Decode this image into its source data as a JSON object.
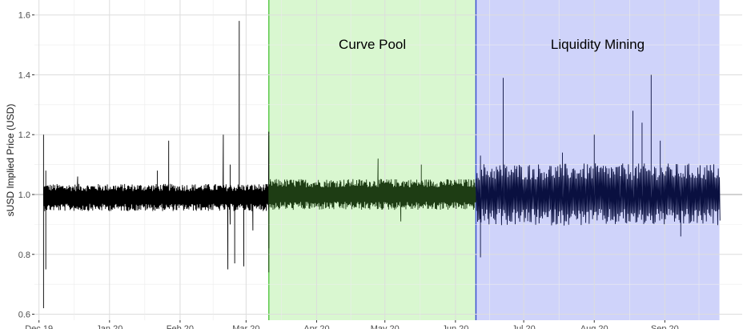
{
  "chart_data": {
    "type": "line",
    "ylabel": "sUSD Implied Price (USD)",
    "xlabel": "",
    "ylim": [
      0.58,
      1.65
    ],
    "xlim": [
      "2019-11-29",
      "2020-10-05"
    ],
    "grid": true,
    "yticks": [
      0.6,
      0.8,
      1.0,
      1.2,
      1.4,
      1.6
    ],
    "ytick_labels": [
      "0.6",
      "0.8",
      "1.0",
      "1.2",
      "1.4",
      "1.6"
    ],
    "xticks": [
      "2019-12-01",
      "2020-01-01",
      "2020-02-01",
      "2020-03-01",
      "2020-04-01",
      "2020-05-01",
      "2020-06-01",
      "2020-07-01",
      "2020-08-01",
      "2020-09-01"
    ],
    "xtick_labels": [
      "Dec 19",
      "Jan 20",
      "Feb 20",
      "Mar 20",
      "Apr 20",
      "May 20",
      "Jun 20",
      "Jul 20",
      "Aug 20",
      "Sep 20"
    ],
    "reference_line": 1.0,
    "regions": [
      {
        "label": "Curve Pool",
        "start": "2020-03-11",
        "end": "2020-06-10",
        "fill": "#d9f7d0",
        "border": "#5cc94a"
      },
      {
        "label": "Liquidity Mining",
        "start": "2020-06-10",
        "end": "2020-09-25",
        "fill": "#cfd3fa",
        "border": "#3b4fd1"
      }
    ],
    "series": [
      {
        "color": "#000000",
        "start": "2019-12-03",
        "end": "2020-03-11",
        "baseline": 0.99,
        "spikes": [
          {
            "date": "2019-12-03",
            "value": 1.2
          },
          {
            "date": "2019-12-03",
            "value": 0.62
          },
          {
            "date": "2019-12-04",
            "value": 0.75
          },
          {
            "date": "2019-12-04",
            "value": 1.08
          },
          {
            "date": "2019-12-18",
            "value": 1.06
          },
          {
            "date": "2020-01-22",
            "value": 1.08
          },
          {
            "date": "2020-01-27",
            "value": 1.18
          },
          {
            "date": "2020-02-20",
            "value": 1.2
          },
          {
            "date": "2020-02-22",
            "value": 0.75
          },
          {
            "date": "2020-02-23",
            "value": 0.9
          },
          {
            "date": "2020-02-23",
            "value": 1.1
          },
          {
            "date": "2020-02-25",
            "value": 0.77
          },
          {
            "date": "2020-02-27",
            "value": 1.58
          },
          {
            "date": "2020-02-29",
            "value": 0.76
          },
          {
            "date": "2020-03-04",
            "value": 0.88
          },
          {
            "date": "2020-03-11",
            "value": 1.21
          },
          {
            "date": "2020-03-11",
            "value": 0.82
          }
        ]
      },
      {
        "color": "#1e3d14",
        "start": "2020-03-11",
        "end": "2020-06-10",
        "baseline": 1.0,
        "spikes": [
          {
            "date": "2020-03-11",
            "value": 0.74
          },
          {
            "date": "2020-04-28",
            "value": 1.12
          },
          {
            "date": "2020-05-08",
            "value": 0.91
          },
          {
            "date": "2020-05-17",
            "value": 1.1
          }
        ]
      },
      {
        "color": "#0a1040",
        "start": "2020-06-10",
        "end": "2020-09-25",
        "baseline": 1.0,
        "spikes": [
          {
            "date": "2020-06-12",
            "value": 0.79
          },
          {
            "date": "2020-06-12",
            "value": 1.13
          },
          {
            "date": "2020-06-22",
            "value": 1.39
          },
          {
            "date": "2020-07-18",
            "value": 1.14
          },
          {
            "date": "2020-08-01",
            "value": 1.2
          },
          {
            "date": "2020-08-12",
            "value": 1.06
          },
          {
            "date": "2020-08-18",
            "value": 1.28
          },
          {
            "date": "2020-08-22",
            "value": 1.24
          },
          {
            "date": "2020-08-26",
            "value": 1.4
          },
          {
            "date": "2020-08-30",
            "value": 1.18
          },
          {
            "date": "2020-09-08",
            "value": 0.86
          }
        ]
      }
    ]
  }
}
